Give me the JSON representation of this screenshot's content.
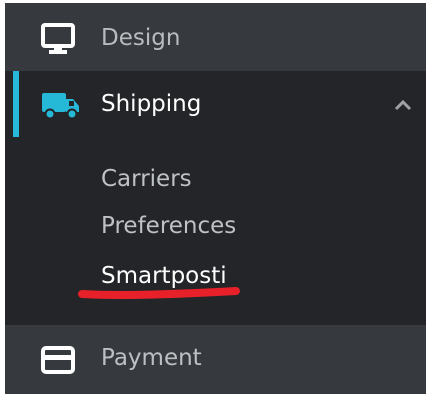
{
  "sidebar": {
    "items": [
      {
        "id": "design",
        "label": "Design",
        "icon": "desktop-monitor-icon"
      },
      {
        "id": "shipping",
        "label": "Shipping",
        "icon": "truck-icon",
        "expanded": true,
        "active": true
      },
      {
        "id": "payment",
        "label": "Payment",
        "icon": "credit-card-icon"
      }
    ],
    "shipping_submenu": [
      {
        "label": "Carriers"
      },
      {
        "label": "Preferences"
      },
      {
        "label": "Smartposti",
        "active": true
      }
    ]
  },
  "colors": {
    "sidebar_bg": "#232528",
    "item_bg": "#363a3e",
    "accent": "#25b9d7",
    "annotation": "#e8202a",
    "text_active": "#ffffff",
    "text_muted": "#c8cacc"
  }
}
